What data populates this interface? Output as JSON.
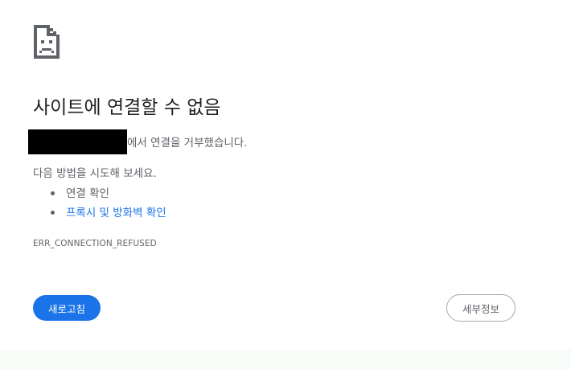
{
  "error": {
    "icon": "sad-document-icon",
    "title": "사이트에 연결할 수 없음",
    "refused_message": "에서 연결을 거부했습니다.",
    "try_text": "다음 방법을 시도해 보세요.",
    "suggestions": [
      {
        "label": "연결 확인",
        "is_link": false
      },
      {
        "label": "프록시 및 방화벽 확인",
        "is_link": true
      }
    ],
    "code": "ERR_CONNECTION_REFUSED"
  },
  "buttons": {
    "reload_label": "새로고침",
    "details_label": "세부정보"
  },
  "colors": {
    "accent": "#1a73e8",
    "text": "#202124",
    "secondary_text": "#5f6368",
    "redaction": "#000000"
  }
}
